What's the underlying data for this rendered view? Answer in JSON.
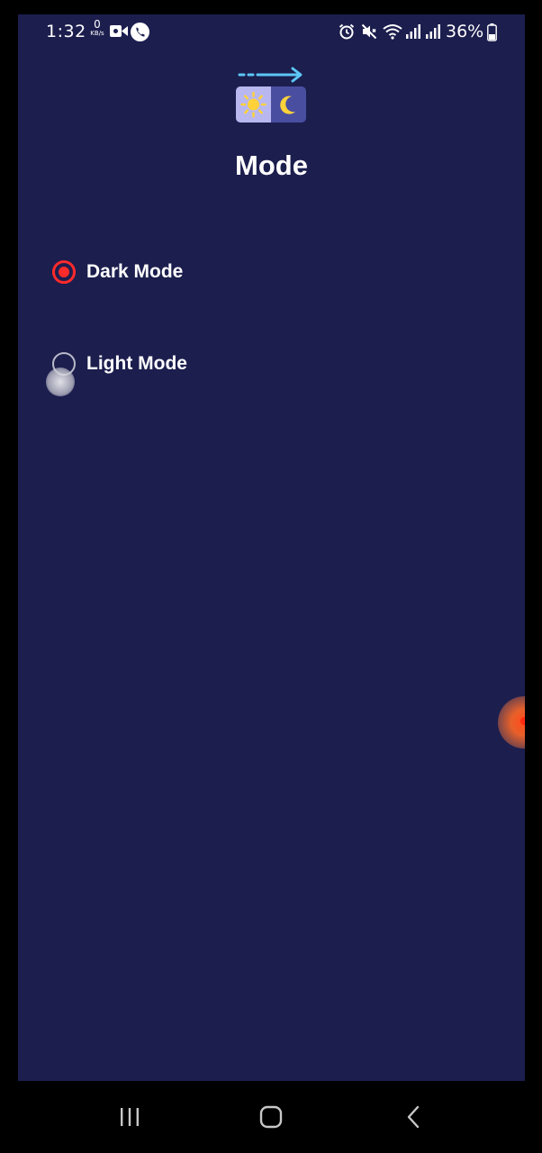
{
  "status_bar": {
    "time": "1:32",
    "net_speed_value": "0",
    "net_speed_unit": "KB/s",
    "battery_percent": "36%",
    "icons": [
      "video-call-icon",
      "phone-call-icon",
      "alarm-icon",
      "mute-icon",
      "wifi-icon",
      "signal-icon",
      "signal-icon",
      "battery-icon"
    ]
  },
  "page": {
    "title": "Mode",
    "icon": "day-night-switch-icon"
  },
  "options": [
    {
      "label": "Dark Mode",
      "selected": true
    },
    {
      "label": "Light Mode",
      "selected": false
    }
  ],
  "colors": {
    "background": "#1c1e4e",
    "radio_selected": "#ff2a2a",
    "radio_unselected": "#b9bac8",
    "text": "#ffffff"
  },
  "nav_bar": {
    "icons": [
      "recent-apps-icon",
      "home-icon",
      "back-icon"
    ]
  }
}
